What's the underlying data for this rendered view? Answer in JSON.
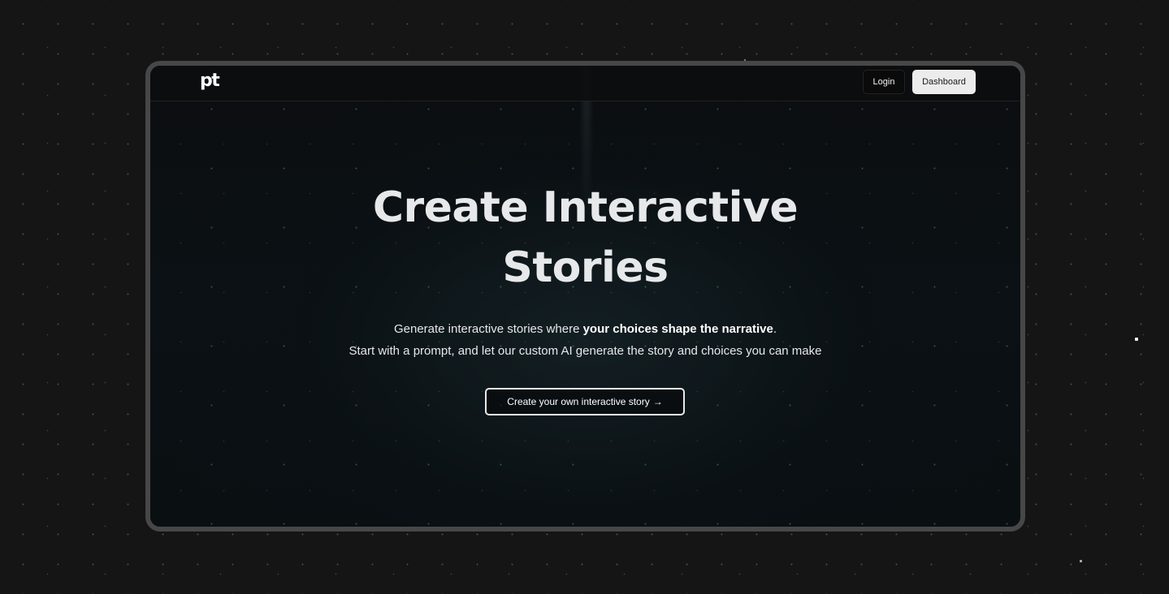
{
  "nav": {
    "logo": "pt",
    "login_label": "Login",
    "dashboard_label": "Dashboard"
  },
  "hero": {
    "title_line1": "Create Interactive",
    "title_line2": "Stories",
    "subtitle_prefix": "Generate interactive stories where ",
    "subtitle_bold": "your choices shape the narrative",
    "subtitle_suffix": ".",
    "subtitle_line2": "Start with a prompt, and let our custom AI generate the story and choices you can make",
    "cta_label": "Create your own interactive story",
    "cta_arrow": "→"
  },
  "colors": {
    "page_background": "#151515",
    "frame_border": "#474747",
    "hero_background": "#0a0f12",
    "text_primary": "#e6e8ea",
    "dashboard_button_bg": "#ececec"
  }
}
